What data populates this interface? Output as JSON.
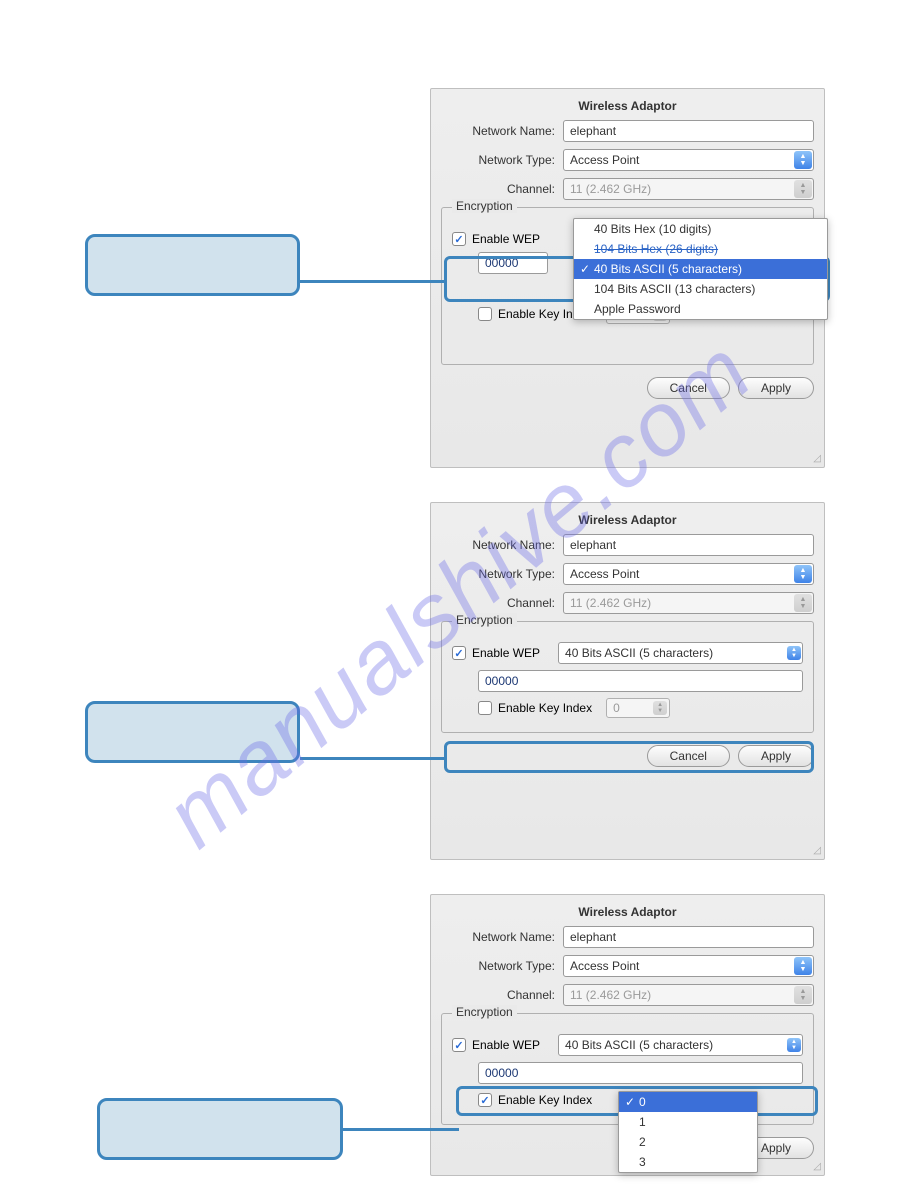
{
  "watermark": "manualshive.com",
  "panel1": {
    "title": "Wireless Adaptor",
    "labels": {
      "name": "Network Name:",
      "type": "Network Type:",
      "channel": "Channel:"
    },
    "values": {
      "name": "elephant",
      "type": "Access Point",
      "channel": "11 (2.462 GHz)"
    },
    "encryption": {
      "legend": "Encryption",
      "enable_wep": "Enable WEP",
      "key_value": "00000",
      "enable_key_index": "Enable Key Index",
      "key_index_value": "0"
    },
    "dropdown": {
      "items": [
        "40 Bits Hex (10 digits)",
        "104 Bits Hex (26 digits)",
        "40 Bits ASCII (5 characters)",
        "104 Bits ASCII (13 characters)",
        "Apple Password"
      ],
      "selected_index": 2
    },
    "buttons": {
      "cancel": "Cancel",
      "apply": "Apply"
    }
  },
  "panel2": {
    "title": "Wireless Adaptor",
    "labels": {
      "name": "Network Name:",
      "type": "Network Type:",
      "channel": "Channel:"
    },
    "values": {
      "name": "elephant",
      "type": "Access Point",
      "channel": "11 (2.462 GHz)"
    },
    "encryption": {
      "legend": "Encryption",
      "enable_wep": "Enable WEP",
      "wep_type": "40 Bits ASCII (5 characters)",
      "key_value": "00000",
      "enable_key_index": "Enable Key Index",
      "key_index_value": "0"
    },
    "buttons": {
      "cancel": "Cancel",
      "apply": "Apply"
    }
  },
  "panel3": {
    "title": "Wireless Adaptor",
    "labels": {
      "name": "Network Name:",
      "type": "Network Type:",
      "channel": "Channel:"
    },
    "values": {
      "name": "elephant",
      "type": "Access Point",
      "channel": "11 (2.462 GHz)"
    },
    "encryption": {
      "legend": "Encryption",
      "enable_wep": "Enable WEP",
      "wep_type": "40 Bits ASCII (5 characters)",
      "key_value": "00000",
      "enable_key_index": "Enable Key Index"
    },
    "key_index_dropdown": {
      "items": [
        "0",
        "1",
        "2",
        "3"
      ],
      "selected_index": 0
    },
    "buttons": {
      "apply": "Apply"
    }
  }
}
